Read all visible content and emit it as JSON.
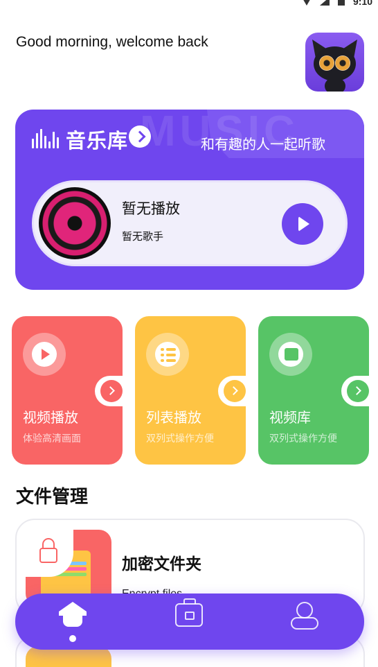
{
  "status_bar": {
    "time": "9:10"
  },
  "header": {
    "greeting": "Good morning, welcome back",
    "avatar_icon": "cat-avatar"
  },
  "music_card": {
    "icon": "music-bars-icon",
    "title": "音乐库",
    "watermark": "MUSIC",
    "slogan": "和有趣的人一起听歌",
    "now_playing": {
      "title": "暂无播放",
      "artist": "暂无歌手"
    }
  },
  "features": [
    {
      "title": "视频播放",
      "subtitle": "体验高清画面",
      "icon": "play-icon",
      "color": "#f96565"
    },
    {
      "title": "列表播放",
      "subtitle": "双列式操作方便",
      "icon": "list-icon",
      "color": "#fec444"
    },
    {
      "title": "视频库",
      "subtitle": "双列式操作方便",
      "icon": "bag-icon",
      "color": "#57c466"
    }
  ],
  "file_section": {
    "title": "文件管理",
    "items": [
      {
        "title": "加密文件夹",
        "subtitle": "Encrypt files"
      }
    ]
  },
  "bottom_nav": {
    "items": [
      "home-icon",
      "toolbox-icon",
      "user-icon"
    ],
    "active": "home-icon"
  },
  "colors": {
    "primary": "#6f46ee",
    "red": "#f96565",
    "yellow": "#fec444",
    "green": "#57c466"
  }
}
